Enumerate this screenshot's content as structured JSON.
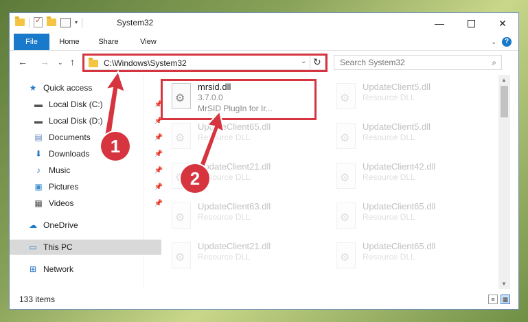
{
  "window": {
    "title": "System32"
  },
  "ribbon": {
    "tabs": [
      "File",
      "Home",
      "Share",
      "View"
    ]
  },
  "address": {
    "path": "C:\\Windows\\System32"
  },
  "search": {
    "placeholder": "Search System32"
  },
  "nav": {
    "quick_access": "Quick access",
    "items": [
      "Local Disk (C:)",
      "Local Disk (D:)",
      "Documents",
      "Downloads",
      "Music",
      "Pictures",
      "Videos"
    ],
    "onedrive": "OneDrive",
    "this_pc": "This PC",
    "network": "Network"
  },
  "files": {
    "highlighted": {
      "name": "mrsid.dll",
      "version": "3.7.0.0",
      "desc": "MrSID PlugIn for Ir..."
    },
    "left_column": [
      {
        "name": "UpdateClient65.dll",
        "desc": "Resource DLL"
      },
      {
        "name": "UpdateClient21.dll",
        "desc": "Resource DLL"
      },
      {
        "name": "UpdateClient63.dll",
        "desc": "Resource DLL"
      },
      {
        "name": "UpdateClient21.dll",
        "desc": "Resource DLL"
      }
    ],
    "right_column": [
      {
        "name": "UpdateClient5.dll",
        "desc": "Resource DLL"
      },
      {
        "name": "UpdateClient5.dll",
        "desc": "Resource DLL"
      },
      {
        "name": "UpdateClient42.dll",
        "desc": "Resource DLL"
      },
      {
        "name": "UpdateClient65.dll",
        "desc": "Resource DLL"
      },
      {
        "name": "UpdateClient65.dll",
        "desc": "Resource DLL"
      }
    ]
  },
  "status": {
    "count": "133 items"
  },
  "callouts": [
    "1",
    "2"
  ],
  "colors": {
    "highlight": "#d6343f",
    "accent": "#1979ca"
  }
}
